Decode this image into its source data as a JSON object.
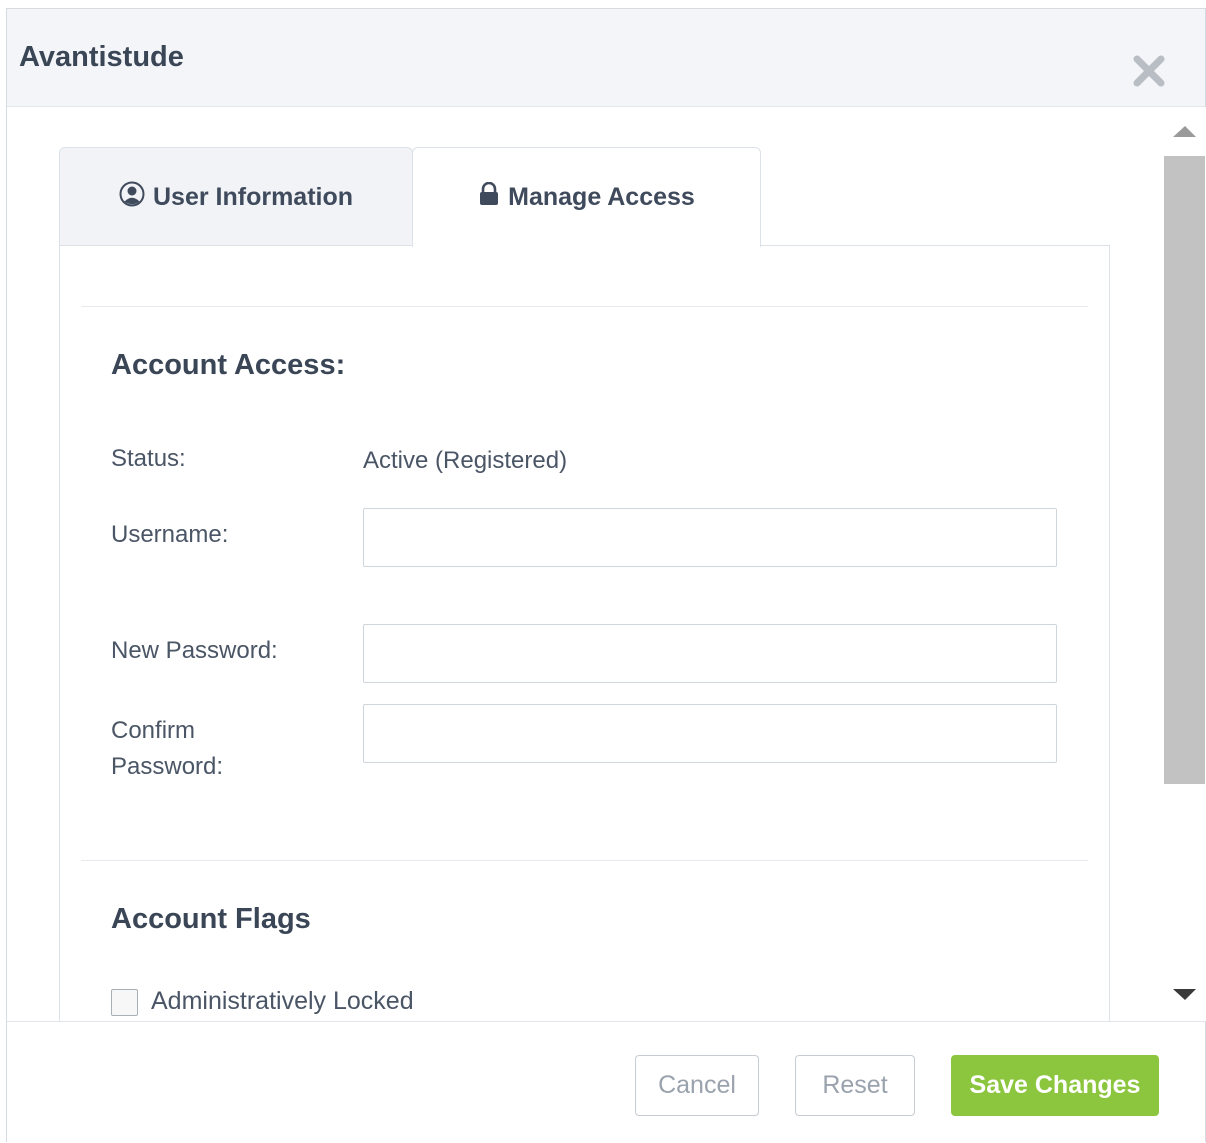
{
  "modal": {
    "title": "Avantistude",
    "close_icon": "close-icon"
  },
  "tabs": [
    {
      "label": "User Information",
      "icon": "user-circle-icon",
      "active": false
    },
    {
      "label": "Manage Access",
      "icon": "lock-icon",
      "active": true
    }
  ],
  "account_access": {
    "title": "Account Access:",
    "status_label": "Status:",
    "status_value": "Active (Registered)",
    "username_label": "Username:",
    "username_value": "",
    "new_password_label": "New Password:",
    "new_password_value": "",
    "confirm_password_label_line1": "Confirm",
    "confirm_password_label_line2": "Password:",
    "confirm_password_value": ""
  },
  "account_flags": {
    "title": "Account Flags",
    "items": [
      {
        "label": "Administratively Locked",
        "checked": false
      }
    ]
  },
  "footer": {
    "cancel_label": "Cancel",
    "reset_label": "Reset",
    "save_label": "Save Changes"
  },
  "colors": {
    "save_button": "#8cc63f",
    "header_bg": "#f3f5f8",
    "scroll_thumb": "#c2c2c2"
  }
}
